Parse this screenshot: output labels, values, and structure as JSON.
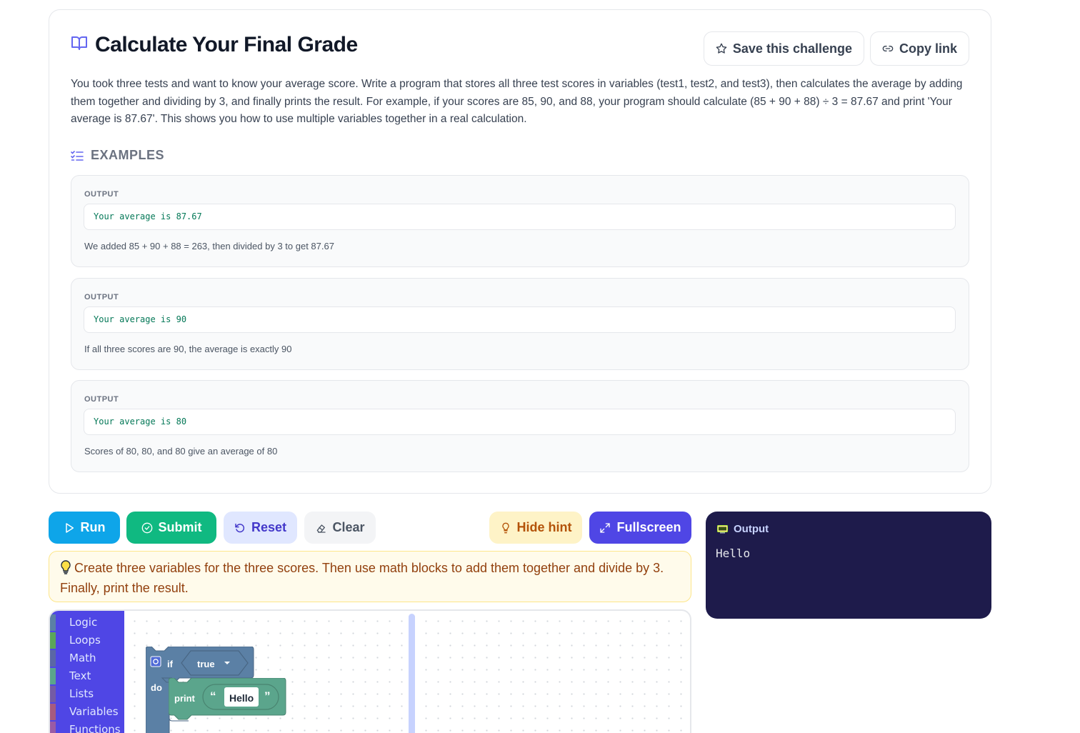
{
  "challenge": {
    "title": "Calculate Your Final Grade",
    "save_label": "Save this challenge",
    "copy_label": "Copy link",
    "description": "You took three tests and want to know your average score. Write a program that stores all three test scores in variables (test1, test2, and test3), then calculates the average by adding them together and dividing by 3, and finally prints the result. For example, if your scores are 85, 90, and 88, your program should calculate (85 + 90 + 88) ÷ 3 = 87.67 and print 'Your average is 87.67'. This shows you how to use multiple variables together in a real calculation.",
    "examples_heading": "EXAMPLES",
    "examples": [
      {
        "label": "OUTPUT",
        "output": "Your average is 87.67",
        "note": "We added 85 + 90 + 88 = 263, then divided by 3 to get 87.67"
      },
      {
        "label": "OUTPUT",
        "output": "Your average is 90",
        "note": "If all three scores are 90, the average is exactly 90"
      },
      {
        "label": "OUTPUT",
        "output": "Your average is 80",
        "note": "Scores of 80, 80, and 80 give an average of 80"
      }
    ]
  },
  "toolbar": {
    "run": "Run",
    "submit": "Submit",
    "reset": "Reset",
    "clear": "Clear",
    "hide_hint": "Hide hint",
    "fullscreen": "Fullscreen"
  },
  "hint": {
    "text": "Create three variables for the three scores. Then use math blocks to add them together and divide by 3. Finally, print the result."
  },
  "output_panel": {
    "title": "Output",
    "text": "Hello"
  },
  "toolbox": {
    "categories": [
      {
        "label": "Logic",
        "color": "#5b80a5"
      },
      {
        "label": "Loops",
        "color": "#5ba55b"
      },
      {
        "label": "Math",
        "color": "#5b67a5"
      },
      {
        "label": "Text",
        "color": "#5ba58c"
      },
      {
        "label": "Lists",
        "color": "#745ba5"
      },
      {
        "label": "Variables",
        "color": "#a55b80"
      },
      {
        "label": "Functions",
        "color": "#995ba5"
      }
    ]
  },
  "blocks": {
    "if_label": "if",
    "condition": "true",
    "do_label": "do",
    "print_label": "print",
    "string_value": "Hello",
    "open_quote": "“",
    "close_quote": "”"
  },
  "colors": {
    "logic_block": "#5b80a5",
    "text_block": "#5ba58c",
    "accent": "#4f46e5"
  }
}
